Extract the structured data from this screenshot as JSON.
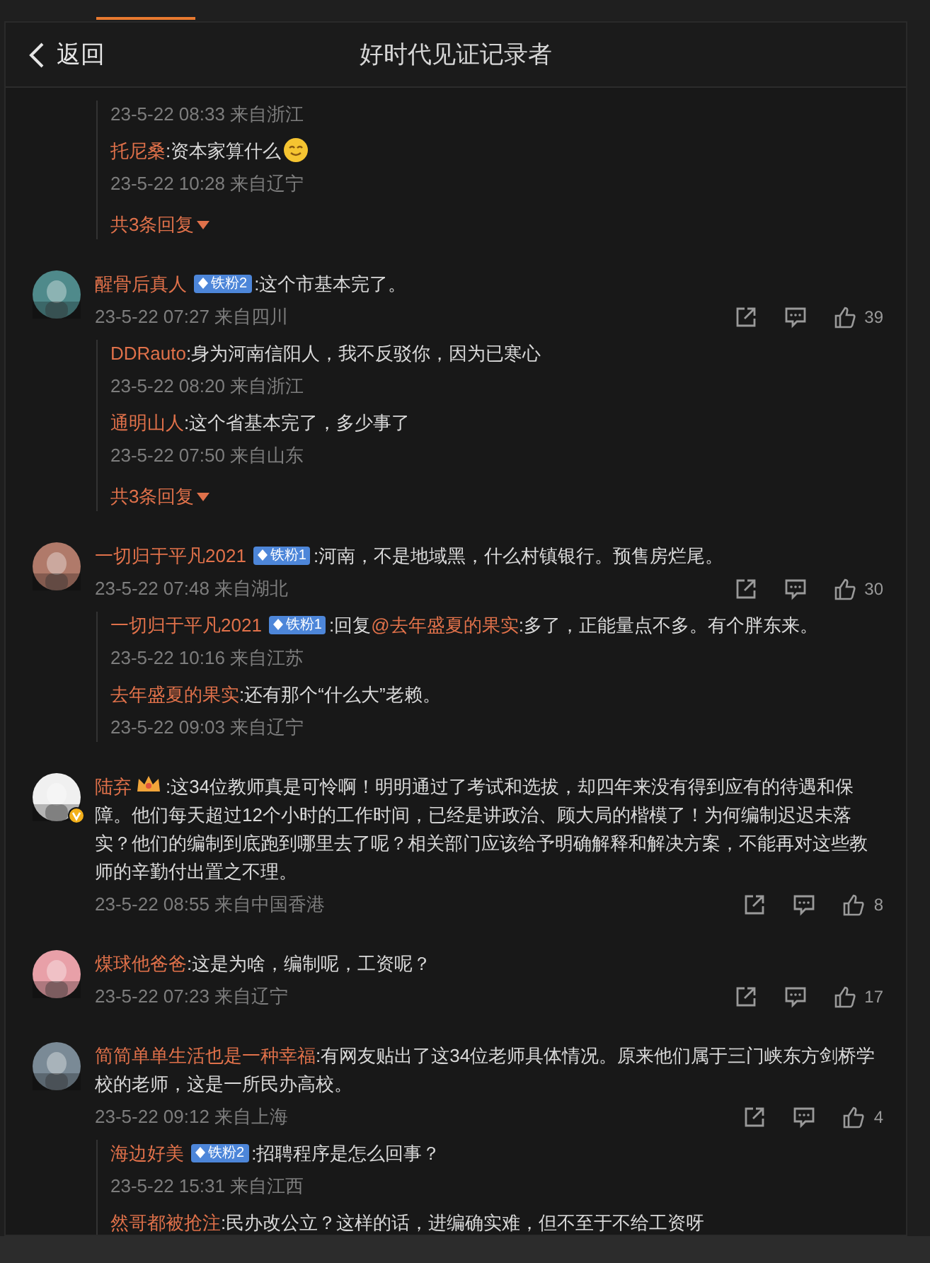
{
  "header": {
    "back_label": "返回",
    "title": "好时代见证记录者"
  },
  "leading_replies": {
    "replies": [
      {
        "time": "23-5-22 08:33 来自浙江"
      },
      {
        "user": "托尼桑",
        "text": ":资本家算什么",
        "emoji": true,
        "time": "23-5-22 10:28 来自辽宁"
      }
    ],
    "more": "共3条回复"
  },
  "comments": [
    {
      "user": "醒骨后真人",
      "verified": false,
      "badges": [
        {
          "kind": "fan",
          "label": "铁粉2"
        }
      ],
      "text": ":这个市基本完了。",
      "time": "23-5-22 07:27 来自四川",
      "likes": "39",
      "replies": [
        {
          "user": "DDRauto",
          "text": ":身为河南信阳人，我不反驳你，因为已寒心",
          "time": "23-5-22 08:20 来自浙江"
        },
        {
          "user": "通明山人",
          "text": ":这个省基本完了，多少事了",
          "time": "23-5-22 07:50 来自山东"
        }
      ],
      "more": "共3条回复"
    },
    {
      "user": "一切归于平凡2021",
      "verified": false,
      "badges": [
        {
          "kind": "fan",
          "label": "铁粉1"
        }
      ],
      "text": ":河南，不是地域黑，什么村镇银行。预售房烂尾。",
      "time": "23-5-22 07:48 来自湖北",
      "likes": "30",
      "replies": [
        {
          "user": "一切归于平凡2021",
          "badges": [
            {
              "kind": "fan",
              "label": "铁粉1"
            }
          ],
          "text": ":回复",
          "mention": "@去年盛夏的果实",
          "text_after": ":多了，正能量点不多。有个胖东来。",
          "time": "23-5-22 10:16 来自江苏"
        },
        {
          "user": "去年盛夏的果实",
          "text": ":还有那个“什么大”老赖。",
          "time": "23-5-22 09:03 来自辽宁"
        }
      ]
    },
    {
      "user": "陆弃",
      "verified": true,
      "badges": [
        {
          "kind": "crown"
        }
      ],
      "text": ":这34位教师真是可怜啊！明明通过了考试和选拔，却四年来没有得到应有的待遇和保障。他们每天超过12个小时的工作时间，已经是讲政治、顾大局的楷模了！为何编制迟迟未落实？他们的编制到底跑到哪里去了呢？相关部门应该给予明确解释和解决方案，不能再对这些教师的辛勤付出置之不理。",
      "time": "23-5-22 08:55 来自中国香港",
      "likes": "8"
    },
    {
      "user": "煤球他爸爸",
      "verified": false,
      "text": ":这是为啥，编制呢，工资呢？",
      "time": "23-5-22 07:23 来自辽宁",
      "likes": "17"
    },
    {
      "user": "简简单单生活也是一种幸福",
      "verified": false,
      "text": ":有网友贴出了这34位老师具体情况。原来他们属于三门峡东方剑桥学校的老师，这是一所民办高校。",
      "time": "23-5-22 09:12 来自上海",
      "likes": "4",
      "replies": [
        {
          "user": "海边好美",
          "badges": [
            {
              "kind": "fan",
              "label": "铁粉2"
            }
          ],
          "text": ":招聘程序是怎么回事？",
          "time": "23-5-22 15:31 来自江西"
        },
        {
          "user": "然哥都被抢注",
          "text": ":民办改公立？这样的话，进编确实难，但不至于不给工资呀"
        }
      ]
    }
  ]
}
